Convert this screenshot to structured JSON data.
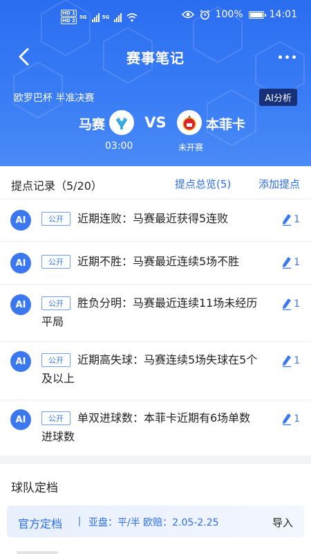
{
  "status_bar": {
    "hd1": "HD 1",
    "hd2": "HD 2",
    "net1": "5G",
    "net2": "5G",
    "battery": "100%",
    "time": "14:01",
    "icons": [
      "eye-icon",
      "alarm-icon",
      "battery-icon",
      "wifi-icon",
      "signal-icon"
    ]
  },
  "nav": {
    "title": "赛事笔记",
    "back_icon": "chevron-left-icon",
    "more_icon": "more-dots-icon"
  },
  "match": {
    "league": "欧罗巴杯  半准决赛",
    "ai_button": "AI分析",
    "home_team": "马赛",
    "away_team": "本菲卡",
    "vs": "VS",
    "time": "03:00",
    "status": "未开赛"
  },
  "tips": {
    "title": "提点记录（5/20）",
    "overview": "提点总览(5)",
    "add": "添加提点",
    "items": [
      {
        "avatar": "AI",
        "tag": "公开",
        "text": "近期连败：马赛最近获得5连败",
        "likes": "1"
      },
      {
        "avatar": "AI",
        "tag": "公开",
        "text": "近期不胜：马赛最近连续5场不胜",
        "likes": "1"
      },
      {
        "avatar": "AI",
        "tag": "公开",
        "text": "胜负分明：马赛最近连续11场未经历平局",
        "likes": "1"
      },
      {
        "avatar": "AI",
        "tag": "公开",
        "text": "近期高失球：马赛连续5场失球在5个及以上",
        "likes": "1"
      },
      {
        "avatar": "AI",
        "tag": "公开",
        "text": "单双进球数：本菲卡近期有6场单数进球数",
        "likes": "1"
      }
    ]
  },
  "archive": {
    "title": "球队定档",
    "label": "官方定档",
    "odds": "亚盘：平/半  欧赔：2.05-2.25",
    "import": "导入"
  },
  "colors": {
    "header_blue": "#2b6df0",
    "accent": "#3b78f0",
    "ai_badge": "#16307a"
  }
}
